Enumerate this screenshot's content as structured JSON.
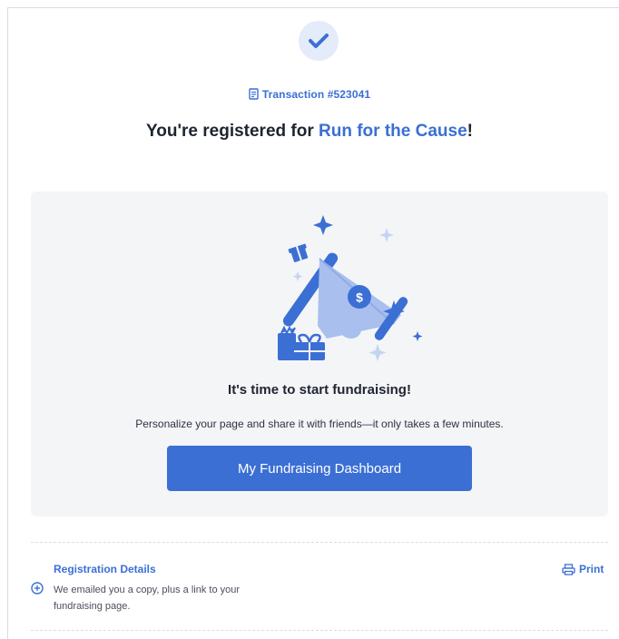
{
  "confirmation": {
    "transaction_label": "Transaction #523041",
    "headline_prefix": "You're registered for ",
    "event_name": "Run for the Cause",
    "headline_suffix": "!"
  },
  "fundraising_card": {
    "title": "It's time to start fundraising!",
    "subtitle": "Personalize your page and share it with friends—it only takes a few minutes.",
    "button_label": "My Fundraising Dashboard",
    "illustration_icons": [
      "megaphone-icon",
      "dollar-icon",
      "gift-icon",
      "sparkle-icon"
    ]
  },
  "registration_details": {
    "title": "Registration Details",
    "description": "We emailed you a copy, plus a link to your fundraising page.",
    "print_label": "Print",
    "expand_icon": "plus-circle-icon",
    "print_icon": "printer-icon"
  },
  "colors": {
    "accent": "#3b6fd4",
    "light_accent": "#e4ebf9",
    "card_bg": "#f4f5f7",
    "text": "#1f2430"
  }
}
